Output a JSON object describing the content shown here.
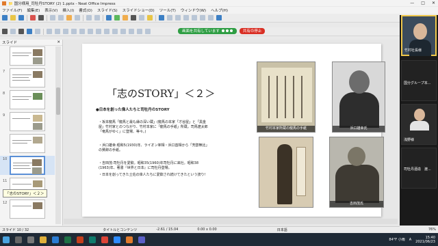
{
  "window": {
    "title": "📁 国分様用_司牡丹STORY (2) 1.pptx - Neat Office Impress",
    "min": "—",
    "max": "□",
    "close": "✕"
  },
  "menu": [
    "ファイル(F)",
    "編集(E)",
    "表示(V)",
    "挿入(I)",
    "書式(O)",
    "スライド(S)",
    "スライドショー(D)",
    "ツール(T)",
    "ウィンドウ(W)",
    "ヘルプ(H)"
  ],
  "share": {
    "sharing": "画面を共有しています",
    "stop": "共有の停止"
  },
  "slides_panel": {
    "header": "スライド",
    "close": "✕",
    "numbers": [
      "",
      "7",
      "8",
      "9",
      "",
      "10",
      "11",
      "12"
    ],
    "tooltip": "「志のSTORY」＜２＞"
  },
  "slide": {
    "title": "「志のSTORY」＜２＞",
    "subtitle": "●日本を創った偉人たちと司牡丹のSTORY",
    "lines": [
      "・坂本龍馬「龍馬と最も縁の深い蔵」(龍馬の本家「才谷屋」と「黒金",
      "屋」竹村家とのつながり、竹村本家に「龍馬の手紙」所蔵。司馬遼太郎",
      "「竜馬がゆく」に登場、等々。)",
      "・浜口雄幸:昭和5(1930)年、ライオン宰相・浜口首相から「芳醇無比」",
      "の賛辞の手紙。",
      "・吉田茂:司牡丹を愛飲。昭和35(1960)年司牡丹に来社。昭和38",
      "(1963)年、著書『世界と日本』に司牡丹登場。",
      "・日本を創ってきた土佐の偉人たちに愛飲され続けてきたという誇り!"
    ],
    "captions": {
      "letter": "竹村本家所蔵の龍馬の手紙",
      "hamaguchi": "浜口雄幸氏",
      "yoshida": "吉田茂氏"
    }
  },
  "participants": [
    {
      "name": "竹村社長様"
    },
    {
      "name": "国分グループ本..."
    },
    {
      "name": "浅野様"
    },
    {
      "name": "司牡丹酒造　渡..."
    }
  ],
  "status": {
    "slide_pos": "スライド 10 / 32",
    "layout": "タイトルとコンテンツ",
    "coords": "-2.61 / 15.04",
    "size": "0.00 x 0.00",
    "lang": "日本語",
    "zoom": "76%"
  },
  "taskbar": {
    "weather": "84°F 小雨",
    "ime": "A",
    "time": "15:40",
    "date": "2021/06/23"
  }
}
